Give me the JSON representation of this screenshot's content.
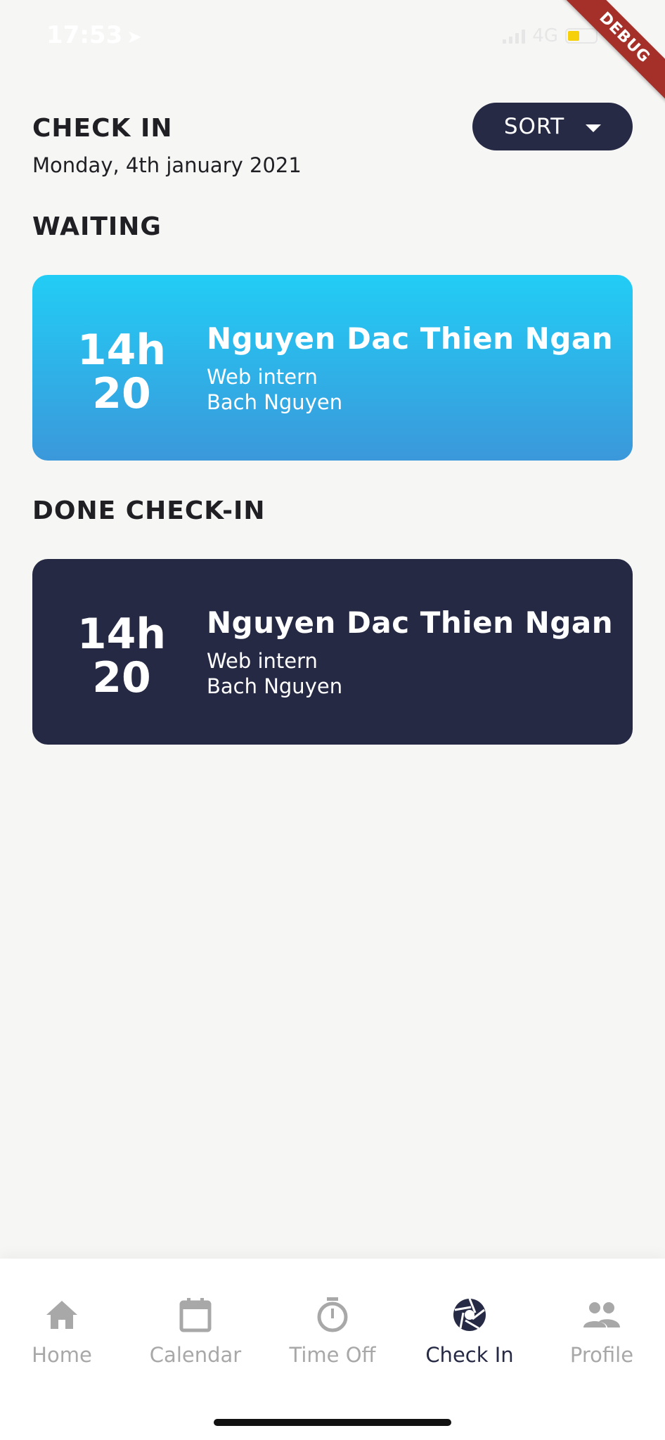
{
  "status_bar": {
    "time": "17:53",
    "network": "4G",
    "battery_color": "#f6d10a"
  },
  "debug_banner": "DEBUG",
  "header": {
    "title": "CHECK IN",
    "date": "Monday, 4th january 2021",
    "sort_label": "SORT"
  },
  "sections": {
    "waiting": {
      "title": "WAITING",
      "card": {
        "hour": "14h",
        "minute": "20",
        "name": "Nguyen Dac Thien Ngan",
        "role": "Web intern",
        "manager": "Bach Nguyen"
      }
    },
    "done": {
      "title": "DONE CHECK-IN",
      "card": {
        "hour": "14h",
        "minute": "20",
        "name": "Nguyen Dac Thien Ngan",
        "role": "Web intern",
        "manager": "Bach Nguyen"
      }
    }
  },
  "nav": {
    "items": [
      {
        "label": "Home",
        "icon": "home-icon"
      },
      {
        "label": "Calendar",
        "icon": "calendar-icon"
      },
      {
        "label": "Time Off",
        "icon": "timer-icon"
      },
      {
        "label": "Check In",
        "icon": "camera-shutter-icon",
        "active": true
      },
      {
        "label": "Profile",
        "icon": "people-icon"
      }
    ]
  },
  "colors": {
    "primary": "#272a45",
    "waiting_top": "#22cdf5",
    "waiting_bottom": "#3b98da",
    "inactive": "#a8a8a8"
  }
}
